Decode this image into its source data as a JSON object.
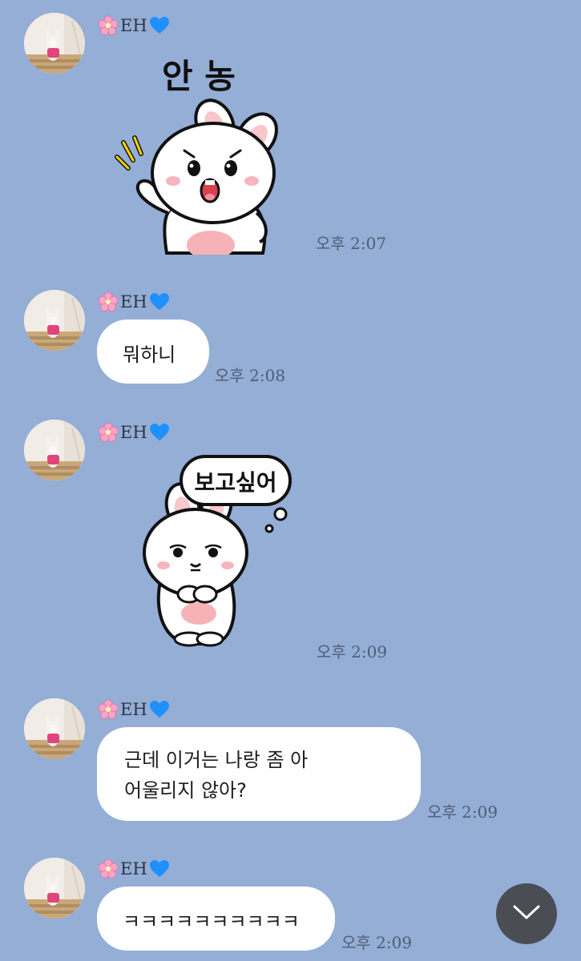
{
  "theme": {
    "background": "#94aed6",
    "bubble": "#ffffff",
    "time_color": "#4f5d75",
    "scroll_button": "#4a4d54"
  },
  "messages": [
    {
      "sender": "EH",
      "sender_prefix_icon": "cherry-blossom-icon",
      "sender_suffix_icon": "blue-heart-icon",
      "type": "sticker",
      "sticker_icon": "waving-bunny-sticker",
      "sticker_text": "안 농",
      "time": "오후 2:07"
    },
    {
      "sender": "EH",
      "sender_prefix_icon": "cherry-blossom-icon",
      "sender_suffix_icon": "blue-heart-icon",
      "type": "text",
      "text": "뭐하니",
      "time": "오후 2:08"
    },
    {
      "sender": "EH",
      "sender_prefix_icon": "cherry-blossom-icon",
      "sender_suffix_icon": "blue-heart-icon",
      "type": "sticker",
      "sticker_icon": "shy-bunny-sticker",
      "sticker_text": "보고싶어",
      "time": "오후 2:09"
    },
    {
      "sender": "EH",
      "sender_prefix_icon": "cherry-blossom-icon",
      "sender_suffix_icon": "blue-heart-icon",
      "type": "text",
      "text_line1": "근데 이거는 나랑 좀 아",
      "text_line2": "어울리지 않아?",
      "time": "오후 2:09"
    },
    {
      "sender": "EH",
      "sender_prefix_icon": "cherry-blossom-icon",
      "sender_suffix_icon": "blue-heart-icon",
      "type": "text",
      "text": "ㅋㅋㅋㅋㅋㅋㅋㅋㅋㅋ",
      "time": "오후 2:09"
    }
  ],
  "scroll_button_icon": "chevron-down-icon"
}
